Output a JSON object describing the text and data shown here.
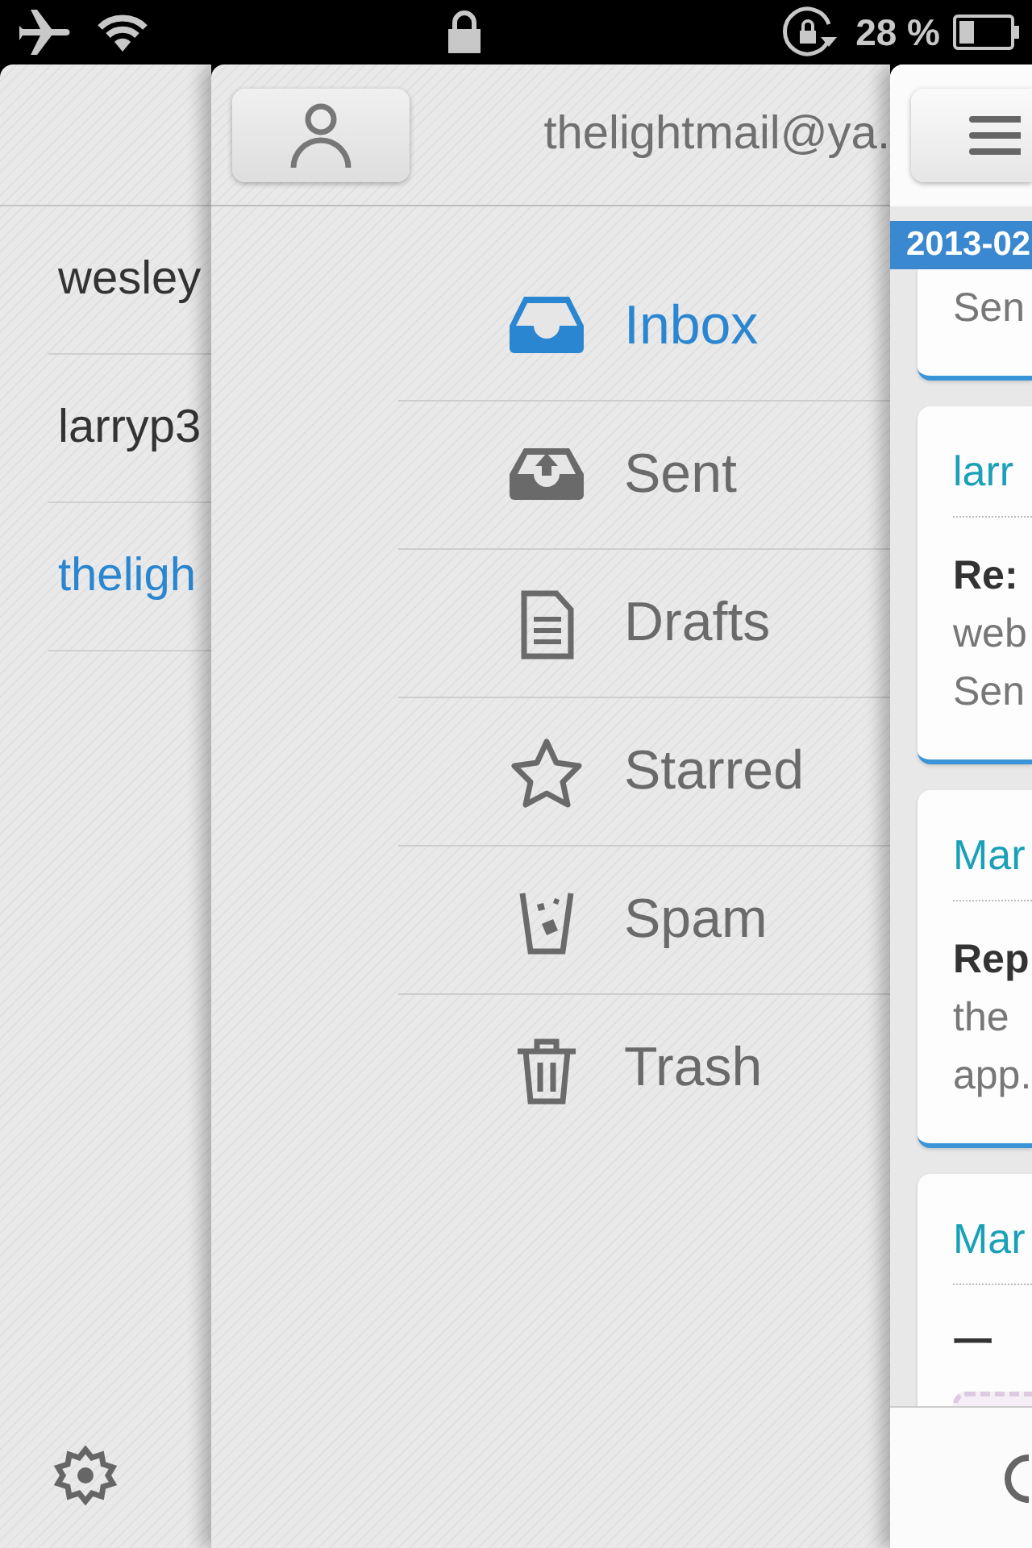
{
  "status_bar": {
    "battery_text": "28 %"
  },
  "accounts": [
    {
      "label": "wesley",
      "selected": false
    },
    {
      "label": "larryp3",
      "selected": false
    },
    {
      "label": "theligh",
      "selected": true
    }
  ],
  "folders_header": {
    "account": "thelightmail@ya."
  },
  "folders": [
    {
      "label": "Inbox",
      "kind": "inbox",
      "selected": true
    },
    {
      "label": "Sent",
      "kind": "sent",
      "selected": false
    },
    {
      "label": "Drafts",
      "kind": "drafts",
      "selected": false
    },
    {
      "label": "Starred",
      "kind": "starred",
      "selected": false
    },
    {
      "label": "Spam",
      "kind": "spam",
      "selected": false
    },
    {
      "label": "Trash",
      "kind": "trash",
      "selected": false
    }
  ],
  "messages": {
    "date_banner": "2013-02",
    "cards": [
      {
        "preview": [
          "Sen"
        ],
        "attachment": false
      },
      {
        "sender": "larr",
        "subject": "Re:",
        "preview": [
          "web",
          "Sen"
        ],
        "attachment": false
      },
      {
        "sender": "Mar",
        "subject": "Rep",
        "preview": [
          "the",
          "app."
        ],
        "attachment": false
      },
      {
        "sender": "Mar",
        "subject": "一",
        "attachment": true
      }
    ]
  }
}
